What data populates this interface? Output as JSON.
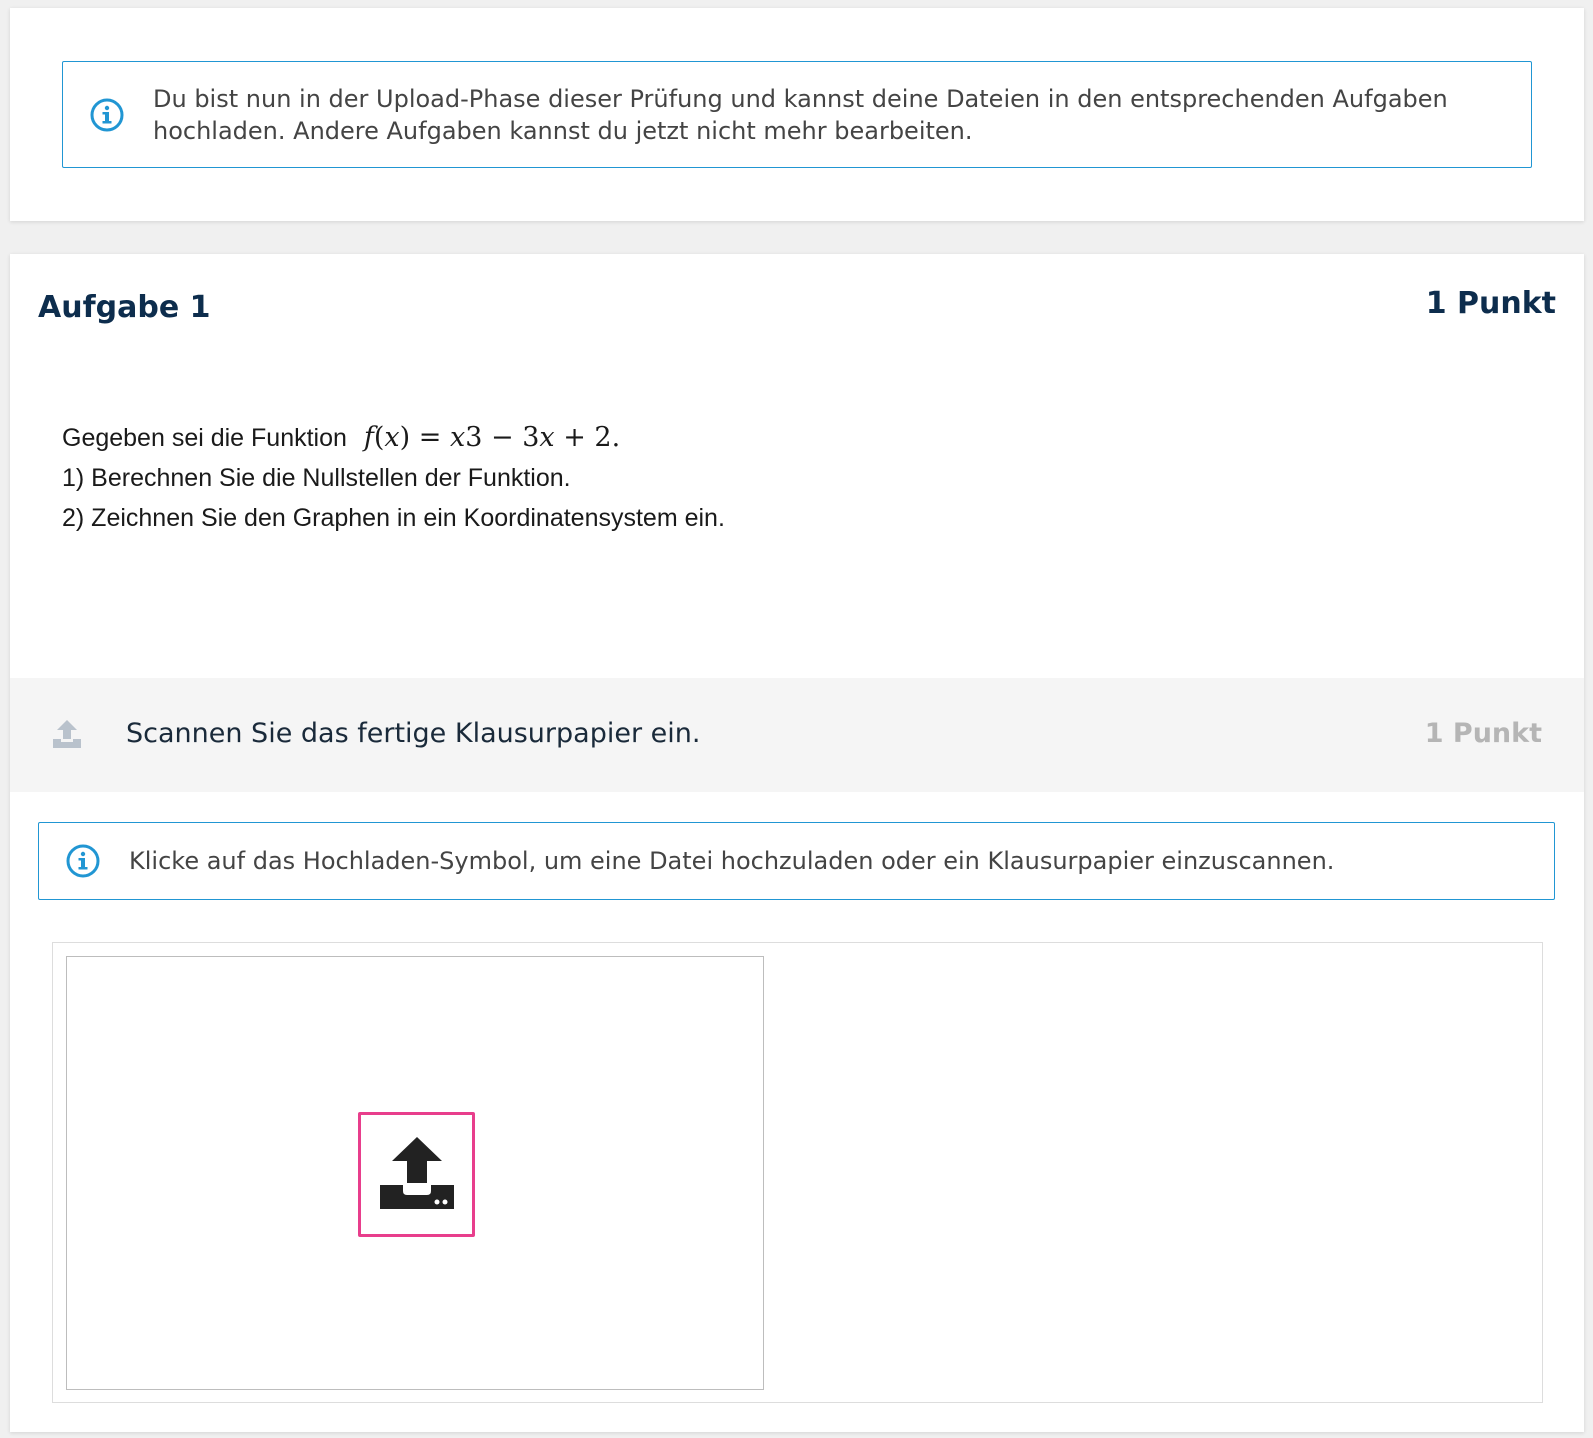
{
  "upload_phase_notice": {
    "text": "Du bist nun in der Upload-Phase dieser Prüfung und kannst deine Dateien in den entsprechenden Aufgaben hochladen. Andere Aufgaben kannst du jetzt nicht mehr bearbeiten.",
    "icon": "info-circle-icon"
  },
  "task": {
    "title": "Aufgabe 1",
    "points": "1 Punkt",
    "intro": "Gegeben sei die Funktion",
    "formula": {
      "f": "f",
      "open": "(",
      "var": "x",
      "close": ")",
      "rest_eq": " = ",
      "x1": "x",
      "rest1": "3 − 3",
      "x2": "x",
      "rest2": " + 2."
    },
    "line1": "1) Berechnen Sie die Nullstellen der Funktion.",
    "line2": "2) Zeichnen Sie den Graphen in ein Koordinatensystem ein."
  },
  "subtask": {
    "icon": "upload-icon",
    "label": "Scannen Sie das fertige Klausurpapier ein.",
    "points": "1 Punkt"
  },
  "upload_hint": {
    "text": "Klicke auf das Hochladen-Symbol, um eine Datei hochzuladen oder ein Klausurpapier einzuscannen.",
    "icon": "info-circle-icon"
  },
  "upload_button": {
    "icon": "upload-icon"
  },
  "colors": {
    "accent_blue": "#2196d3",
    "title_navy": "#0d2d4d",
    "highlight_pink": "#e83e8c",
    "muted_gray": "#b5b5b5"
  }
}
